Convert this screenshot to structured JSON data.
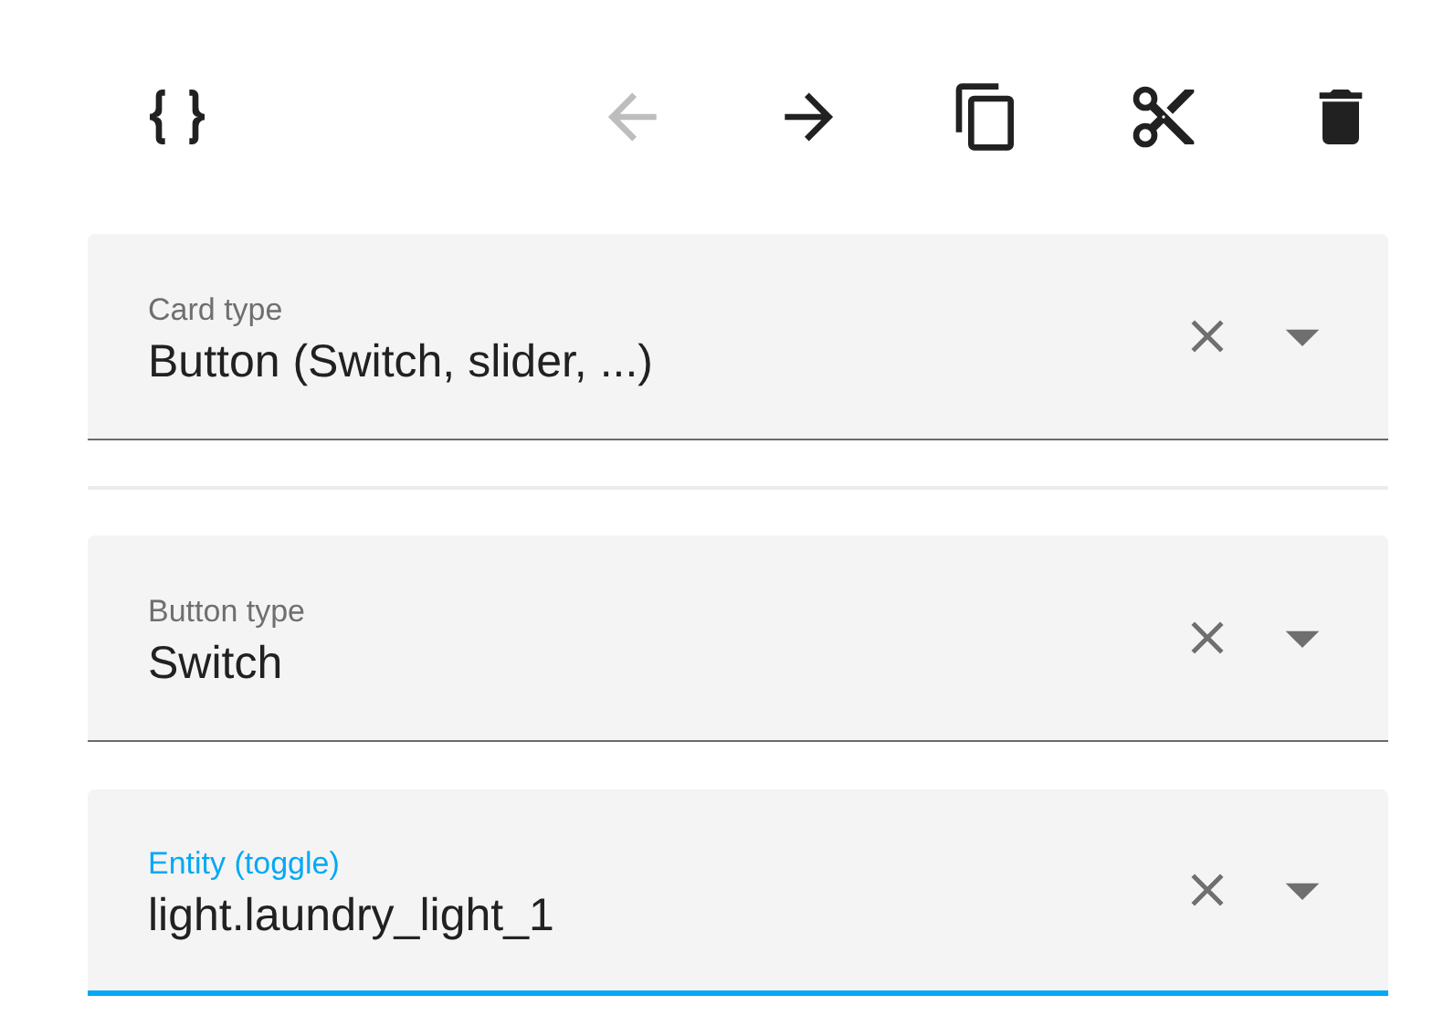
{
  "toolbar": [
    {
      "kind": "code",
      "disabled": false
    },
    {
      "kind": "back",
      "disabled": true
    },
    {
      "kind": "forward",
      "disabled": false
    },
    {
      "kind": "copy",
      "disabled": false
    },
    {
      "kind": "cut",
      "disabled": false
    },
    {
      "kind": "delete",
      "disabled": false
    }
  ],
  "fields": [
    {
      "label": "Card type",
      "value": "Button (Switch, slider, ...)",
      "focused": false
    },
    {
      "label": "Button type",
      "value": "Switch",
      "focused": false
    },
    {
      "label": "Entity (toggle)",
      "value": "light.laundry_light_1",
      "focused": true
    }
  ]
}
